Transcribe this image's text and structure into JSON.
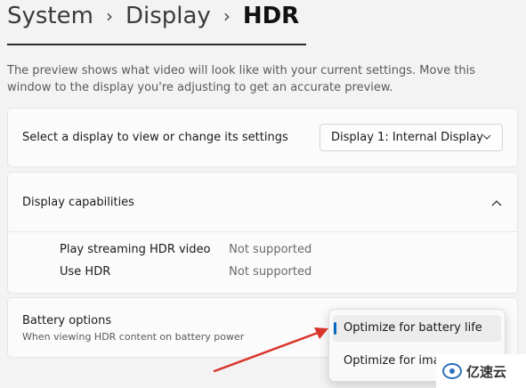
{
  "breadcrumb": {
    "items": [
      "System",
      "Display"
    ],
    "current": "HDR",
    "separator": "›"
  },
  "description": "The preview shows what video will look like with your current settings. Move this window to the display you're adjusting to get an accurate preview.",
  "display_select": {
    "label": "Select a display to view or change its settings",
    "value": "Display 1: Internal Display",
    "icon": "chevron-down-icon"
  },
  "capabilities": {
    "title": "Display capabilities",
    "expanded": true,
    "icon": "chevron-up-icon",
    "rows": [
      {
        "name": "Play streaming HDR video",
        "value": "Not supported"
      },
      {
        "name": "Use HDR",
        "value": "Not supported"
      }
    ]
  },
  "battery": {
    "title": "Battery options",
    "subtitle": "When viewing HDR content on battery power",
    "options": [
      "Optimize for battery life",
      "Optimize for ima"
    ],
    "selected_index": 0
  },
  "watermark": {
    "text": "亿速云",
    "icon": "cloud-logo-icon"
  },
  "colors": {
    "accent": "#0067c0",
    "annotation_arrow": "#d9342b"
  }
}
